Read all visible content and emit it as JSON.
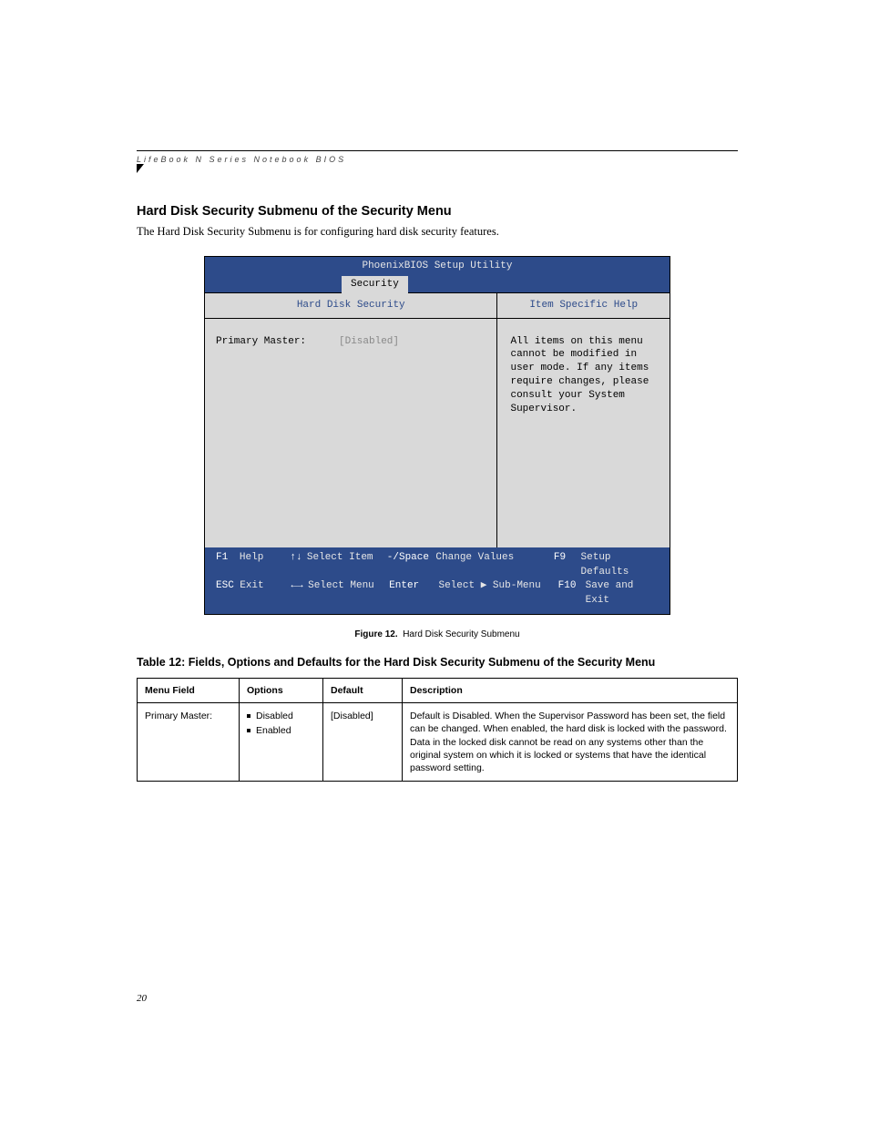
{
  "runningHead": "LifeBook N Series Notebook BIOS",
  "sectionTitle": "Hard Disk Security Submenu of the Security Menu",
  "intro": "The Hard Disk Security Submenu is for configuring hard disk security features.",
  "bios": {
    "title": "PhoenixBIOS Setup Utility",
    "tab": "Security",
    "leftHeader": "Hard Disk Security",
    "rightHeader": "Item Specific Help",
    "rowLabel": "Primary Master:",
    "rowValue": "[Disabled]",
    "helpText": "All items on this menu cannot be modified in user mode. If any items require changes, please consult your System Supervisor.",
    "footer": {
      "r1": {
        "k1": "F1",
        "l1": "Help",
        "a1": "↑↓",
        "t1": "Select Item",
        "k2": "-/Space",
        "t2": "Change Values",
        "k3": "F9",
        "t3": "Setup Defaults"
      },
      "r2": {
        "k1": "ESC",
        "l1": "Exit",
        "a1": "←→",
        "t1": "Select Menu",
        "k2": "Enter",
        "t2": "Select ▶ Sub-Menu",
        "k3": "F10",
        "t3": "Save and Exit"
      }
    }
  },
  "figCaption": {
    "label": "Figure 12.",
    "text": "Hard Disk Security Submenu"
  },
  "tableTitle": "Table 12: Fields, Options and Defaults for the Hard Disk Security Submenu of the Security Menu",
  "table": {
    "headers": {
      "field": "Menu Field",
      "options": "Options",
      "default": "Default",
      "desc": "Description"
    },
    "row": {
      "field": "Primary Master:",
      "opt1": "Disabled",
      "opt2": "Enabled",
      "default": "[Disabled]",
      "desc": "Default is Disabled. When the Supervisor Password has been set, the field can be changed. When enabled, the hard disk is locked with the password. Data in the locked disk cannot be read on any systems other than the original system on which it is locked or systems that have the identical password setting."
    }
  },
  "pageNumber": "20"
}
